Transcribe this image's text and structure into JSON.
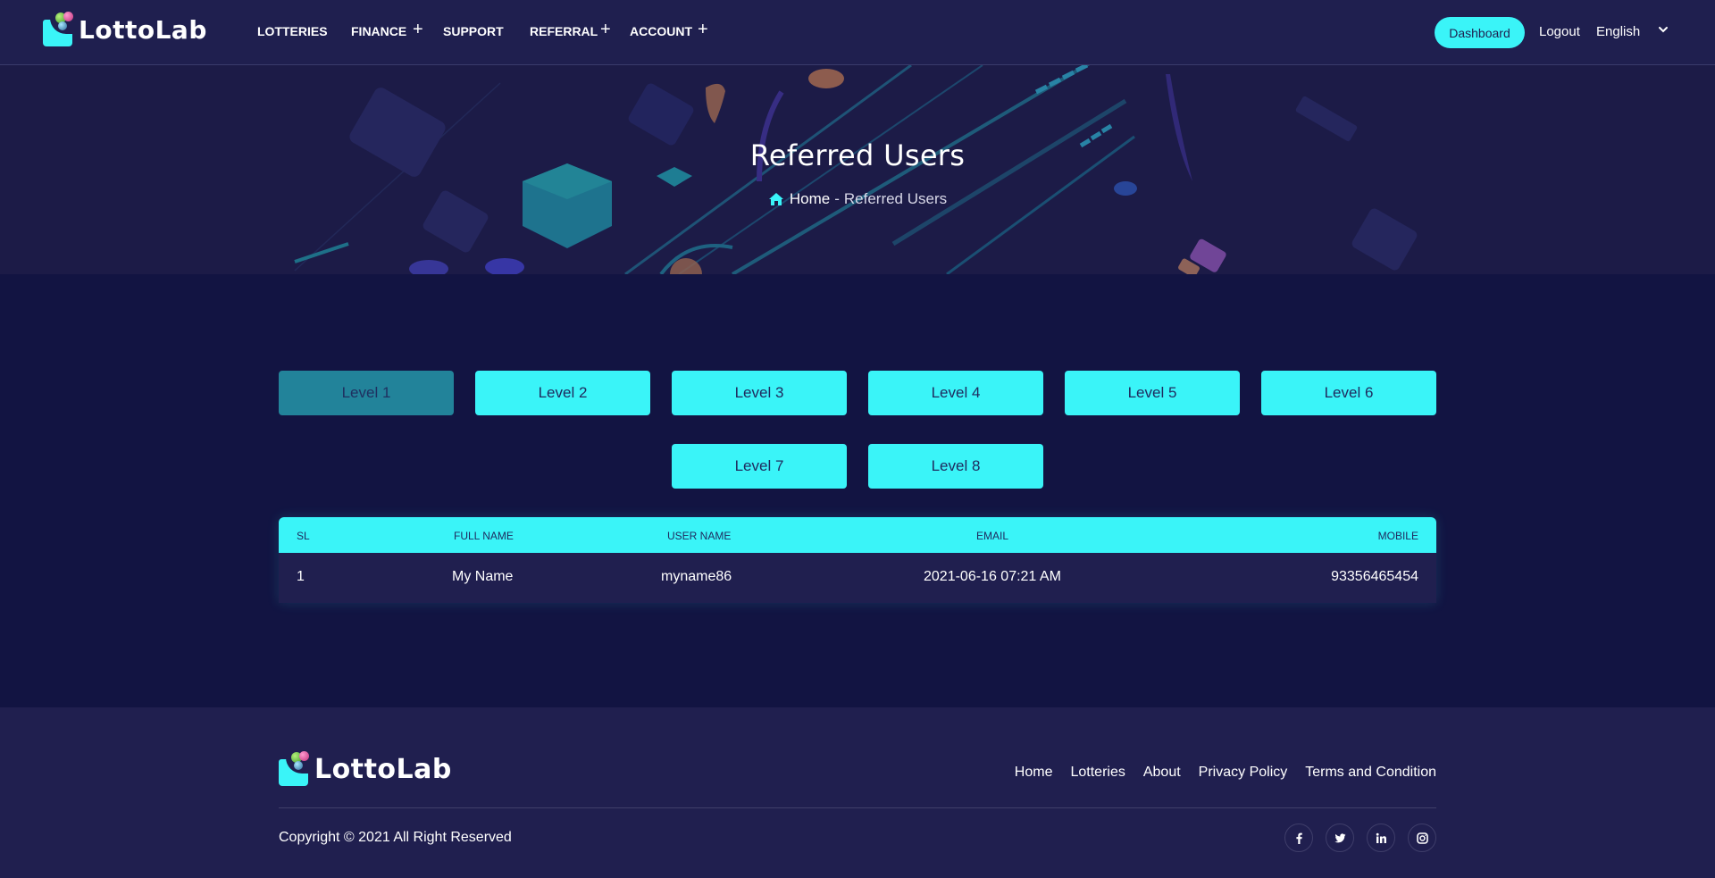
{
  "brand": {
    "name": "LottoLab"
  },
  "header": {
    "nav": [
      {
        "label": "Lotteries",
        "has_submenu": false
      },
      {
        "label": "Finance",
        "has_submenu": true
      },
      {
        "label": "Support",
        "has_submenu": false
      },
      {
        "label": "Referral",
        "has_submenu": true
      },
      {
        "label": "Account",
        "has_submenu": true
      }
    ],
    "dashboard_label": "Dashboard",
    "logout_label": "Logout",
    "language": "English"
  },
  "banner": {
    "title": "Referred Users",
    "breadcrumb": {
      "home": "Home",
      "separator": "-",
      "current": "Referred Users"
    }
  },
  "levels": {
    "active_index": 0,
    "items": [
      "Level 1",
      "Level 2",
      "Level 3",
      "Level 4",
      "Level 5",
      "Level 6",
      "Level 7",
      "Level 8"
    ]
  },
  "table": {
    "columns": [
      "SL",
      "Full Name",
      "User Name",
      "Email",
      "Mobile"
    ],
    "rows": [
      [
        "1",
        "My Name",
        "myname86",
        "2021-06-16 07:21 AM",
        "93356465454"
      ]
    ]
  },
  "footer": {
    "links": [
      "Home",
      "Lotteries",
      "About",
      "Privacy Policy",
      "Terms and Condition"
    ],
    "copyright": "Copyright © 2021 All Right Reserved",
    "socials": [
      "facebook-icon",
      "twitter-icon",
      "linkedin-icon",
      "instagram-icon"
    ]
  },
  "colors": {
    "accent": "#3af4f8",
    "active_level": "#22839a",
    "header_bg": "#1f1f4f",
    "page_bg": "#121442",
    "footer_bg": "#201f4f"
  }
}
